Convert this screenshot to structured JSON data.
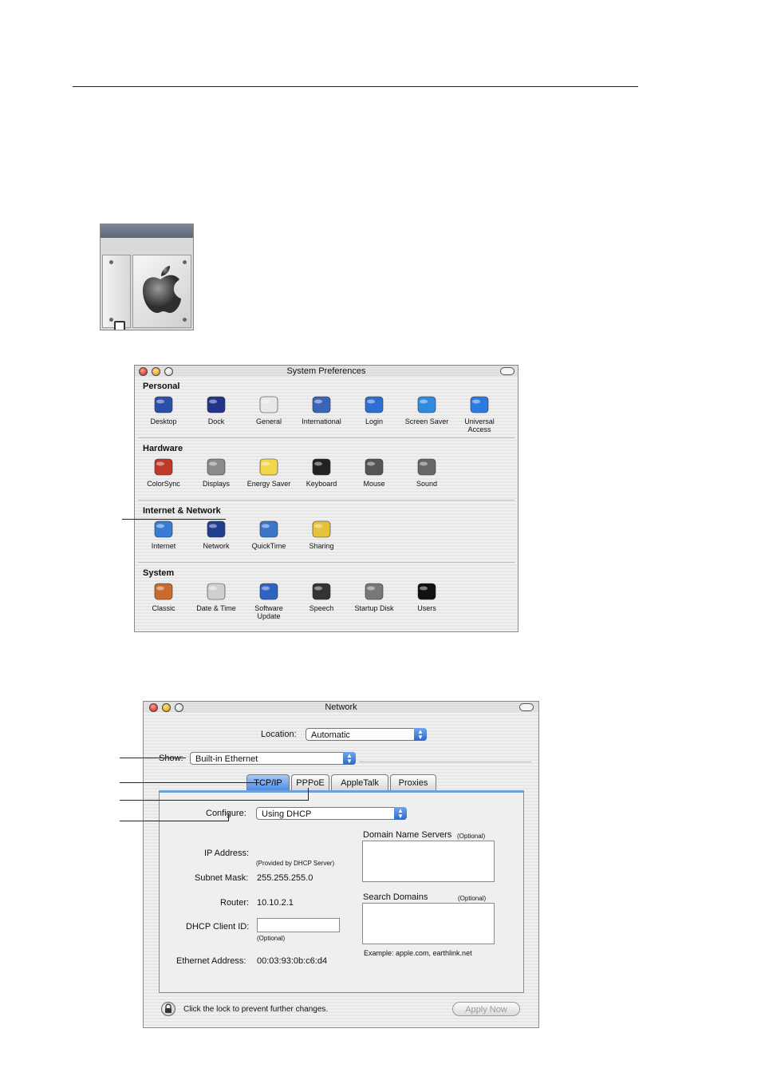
{
  "syspref": {
    "title": "System Preferences",
    "sections": [
      {
        "title": "Personal",
        "items": [
          {
            "label": "Desktop",
            "icon": "desktop-icon"
          },
          {
            "label": "Dock",
            "icon": "dock-icon"
          },
          {
            "label": "General",
            "icon": "general-icon"
          },
          {
            "label": "International",
            "icon": "international-icon"
          },
          {
            "label": "Login",
            "icon": "login-icon"
          },
          {
            "label": "Screen Saver",
            "icon": "screen-saver-icon"
          },
          {
            "label": "Universal\nAccess",
            "icon": "universal-access-icon"
          }
        ]
      },
      {
        "title": "Hardware",
        "items": [
          {
            "label": "ColorSync",
            "icon": "colorsync-icon"
          },
          {
            "label": "Displays",
            "icon": "displays-icon"
          },
          {
            "label": "Energy Saver",
            "icon": "energy-saver-icon"
          },
          {
            "label": "Keyboard",
            "icon": "keyboard-icon"
          },
          {
            "label": "Mouse",
            "icon": "mouse-icon"
          },
          {
            "label": "Sound",
            "icon": "sound-icon"
          }
        ]
      },
      {
        "title": "Internet & Network",
        "items": [
          {
            "label": "Internet",
            "icon": "internet-icon"
          },
          {
            "label": "Network",
            "icon": "network-icon"
          },
          {
            "label": "QuickTime",
            "icon": "quicktime-icon"
          },
          {
            "label": "Sharing",
            "icon": "sharing-icon"
          }
        ]
      },
      {
        "title": "System",
        "items": [
          {
            "label": "Classic",
            "icon": "classic-icon"
          },
          {
            "label": "Date & Time",
            "icon": "date-time-icon"
          },
          {
            "label": "Software\nUpdate",
            "icon": "software-update-icon"
          },
          {
            "label": "Speech",
            "icon": "speech-icon"
          },
          {
            "label": "Startup Disk",
            "icon": "startup-disk-icon"
          },
          {
            "label": "Users",
            "icon": "users-icon"
          }
        ]
      }
    ]
  },
  "network": {
    "title": "Network",
    "location_label": "Location:",
    "location_value": "Automatic",
    "show_label": "Show:",
    "show_value": "Built-in Ethernet",
    "tabs": [
      "TCP/IP",
      "PPPoE",
      "AppleTalk",
      "Proxies"
    ],
    "configure_label": "Configure:",
    "configure_value": "Using DHCP",
    "ip_label": "IP Address:",
    "ip_note": "(Provided by DHCP Server)",
    "subnet_label": "Subnet Mask:",
    "subnet_value": "255.255.255.0",
    "router_label": "Router:",
    "router_value": "10.10.2.1",
    "dhcp_label": "DHCP Client ID:",
    "dhcp_note": "(Optional)",
    "ethernet_label": "Ethernet Address:",
    "ethernet_value": "00:03:93:0b:c6:d4",
    "dns_label": "Domain Name Servers",
    "dns_optional": "(Optional)",
    "search_label": "Search Domains",
    "search_optional": "(Optional)",
    "search_example": "Example: apple.com, earthlink.net",
    "lock_text": "Click the lock to prevent further changes.",
    "apply_label": "Apply Now"
  },
  "colors": {
    "accent": "#4c8de6",
    "close": "#cc1a10",
    "minimize": "#e09a00"
  }
}
